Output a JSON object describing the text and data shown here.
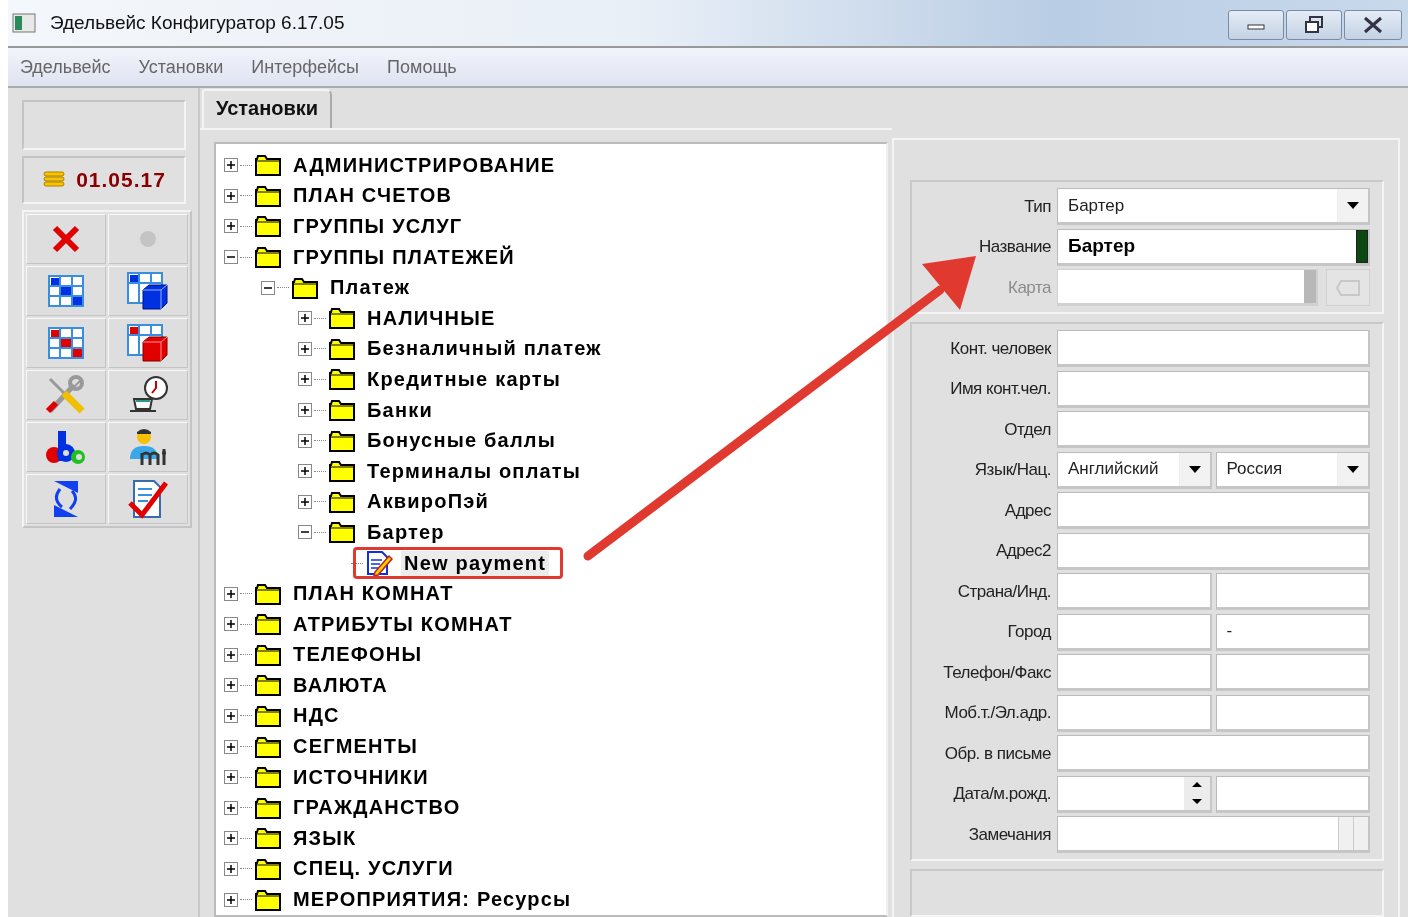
{
  "window": {
    "title": "Эдельвейс Конфигуратор 6.17.05"
  },
  "menu": [
    "Эдельвейс",
    "Установки",
    "Интерфейсы",
    "Помощь"
  ],
  "sidebar": {
    "date": "01.05.17"
  },
  "tabs": [
    {
      "label": "Установки",
      "selected": true
    }
  ],
  "tree": [
    {
      "kind": "folder",
      "label": "АДМИНИСТРИРОВАНИЕ",
      "expanded": false,
      "selected": false
    },
    {
      "kind": "folder",
      "label": "ПЛАН СЧЕТОВ",
      "expanded": false,
      "selected": false
    },
    {
      "kind": "folder",
      "label": "ГРУППЫ УСЛУГ",
      "expanded": false,
      "selected": false
    },
    {
      "kind": "folder",
      "label": "ГРУППЫ ПЛАТЕЖЕЙ",
      "expanded": true,
      "selected": false,
      "children": [
        {
          "kind": "folder",
          "label": "Платеж",
          "expanded": true,
          "selected": false,
          "children": [
            {
              "kind": "folder",
              "label": "НАЛИЧНЫЕ",
              "expanded": false,
              "selected": false
            },
            {
              "kind": "folder",
              "label": "Безналичный платеж",
              "expanded": false,
              "selected": false
            },
            {
              "kind": "folder",
              "label": "Кредитные карты",
              "expanded": false,
              "selected": false
            },
            {
              "kind": "folder",
              "label": "Банки",
              "expanded": false,
              "selected": false
            },
            {
              "kind": "folder",
              "label": "Бонусные баллы",
              "expanded": false,
              "selected": false
            },
            {
              "kind": "folder",
              "label": "Терминалы оплаты",
              "expanded": false,
              "selected": false
            },
            {
              "kind": "folder",
              "label": "АквироПэй",
              "expanded": false,
              "selected": false
            },
            {
              "kind": "folder",
              "label": "Бартер",
              "expanded": true,
              "selected": false,
              "children": [
                {
                  "kind": "document",
                  "label": "New payment",
                  "selected": true
                }
              ]
            }
          ]
        }
      ]
    },
    {
      "kind": "folder",
      "label": "ПЛАН КОМНАТ",
      "expanded": false,
      "selected": false
    },
    {
      "kind": "folder",
      "label": "АТРИБУТЫ КОМНАТ",
      "expanded": false,
      "selected": false
    },
    {
      "kind": "folder",
      "label": "ТЕЛЕФОНЫ",
      "expanded": false,
      "selected": false
    },
    {
      "kind": "folder",
      "label": "ВАЛЮТА",
      "expanded": false,
      "selected": false
    },
    {
      "kind": "folder",
      "label": "НДС",
      "expanded": false,
      "selected": false
    },
    {
      "kind": "folder",
      "label": "СЕГМЕНТЫ",
      "expanded": false,
      "selected": false
    },
    {
      "kind": "folder",
      "label": "ИСТОЧНИКИ",
      "expanded": false,
      "selected": false
    },
    {
      "kind": "folder",
      "label": "ГРАЖДАНСТВО",
      "expanded": false,
      "selected": false
    },
    {
      "kind": "folder",
      "label": "ЯЗЫК",
      "expanded": false,
      "selected": false
    },
    {
      "kind": "folder",
      "label": "СПЕЦ. УСЛУГИ",
      "expanded": false,
      "selected": false
    },
    {
      "kind": "folder",
      "label": "МЕРОПРИЯТИЯ: Ресурсы",
      "expanded": false,
      "selected": false
    }
  ],
  "form": {
    "sections": [
      {
        "rows": [
          {
            "label": "Тип",
            "disabled": false,
            "inputs": [
              {
                "kind": "combo",
                "value": "Бартер"
              }
            ]
          },
          {
            "label": "Название",
            "disabled": false,
            "inputs": [
              {
                "kind": "name",
                "value": "Бартер"
              }
            ]
          },
          {
            "label": "Карта",
            "disabled": true,
            "inputs": [
              {
                "kind": "card"
              }
            ]
          }
        ]
      },
      {
        "rows": [
          {
            "label": "Конт. человек",
            "disabled": false,
            "inputs": [
              {
                "kind": "text"
              }
            ]
          },
          {
            "label": "Имя конт.чел.",
            "disabled": false,
            "inputs": [
              {
                "kind": "text"
              }
            ]
          },
          {
            "label": "Отдел",
            "disabled": false,
            "inputs": [
              {
                "kind": "text"
              }
            ]
          },
          {
            "label": "Язык/Нац.",
            "disabled": false,
            "inputs": [
              {
                "kind": "combo",
                "value": "Английский"
              },
              {
                "kind": "combo",
                "value": "Россия"
              }
            ]
          },
          {
            "label": "Адрес",
            "disabled": false,
            "inputs": [
              {
                "kind": "text"
              }
            ]
          },
          {
            "label": "Адрес2",
            "disabled": false,
            "inputs": [
              {
                "kind": "text"
              }
            ]
          },
          {
            "label": "Страна/Инд.",
            "disabled": false,
            "inputs": [
              {
                "kind": "text"
              },
              {
                "kind": "text"
              }
            ]
          },
          {
            "label": "Город",
            "disabled": false,
            "inputs": [
              {
                "kind": "text"
              },
              {
                "kind": "text",
                "value": "-"
              }
            ]
          },
          {
            "label": "Телефон/Факс",
            "disabled": false,
            "inputs": [
              {
                "kind": "text"
              },
              {
                "kind": "text"
              }
            ]
          },
          {
            "label": "Моб.т./Эл.адр.",
            "disabled": false,
            "inputs": [
              {
                "kind": "text"
              },
              {
                "kind": "text"
              }
            ]
          },
          {
            "label": "Обр. в письме",
            "disabled": false,
            "inputs": [
              {
                "kind": "text"
              }
            ]
          },
          {
            "label": "Дата/м.рожд.",
            "disabled": false,
            "inputs": [
              {
                "kind": "spin"
              },
              {
                "kind": "text"
              }
            ]
          },
          {
            "label": "Замечания",
            "disabled": false,
            "inputs": [
              {
                "kind": "memo"
              }
            ]
          }
        ]
      }
    ]
  }
}
